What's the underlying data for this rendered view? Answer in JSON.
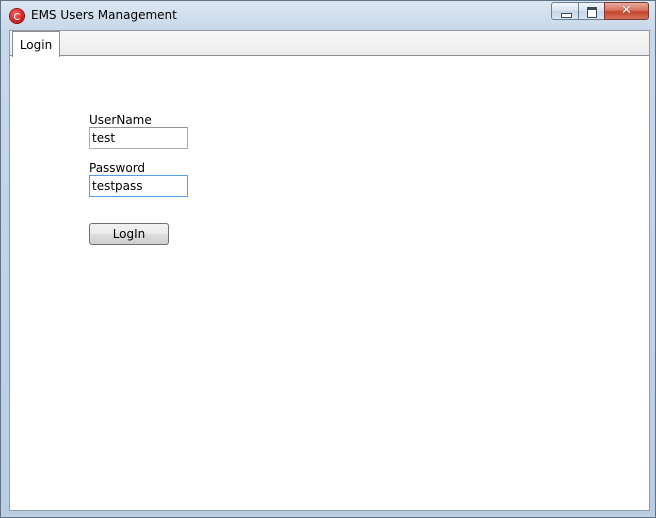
{
  "window": {
    "title": "EMS Users Management"
  },
  "tabs": [
    {
      "label": "Login"
    }
  ],
  "login_form": {
    "username_label": "UserName",
    "username_value": "test",
    "password_label": "Password",
    "password_value": "testpass",
    "login_button": "LogIn"
  },
  "colors": {
    "frame": "#b9cde3",
    "close_button": "#c4452b",
    "focus_border": "#569de5"
  }
}
